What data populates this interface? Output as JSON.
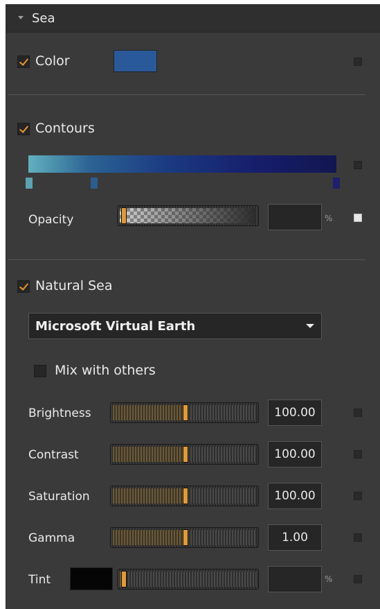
{
  "section": {
    "title": "Sea"
  },
  "color": {
    "label": "Color",
    "checked": true,
    "swatch_color": "#2a5999"
  },
  "contours": {
    "label": "Contours",
    "checked": true,
    "gradient_colors": [
      "#62b0bf",
      "#2b6394",
      "#1b3a82",
      "#161d6a",
      "#121650"
    ],
    "stop_colors": [
      "#5aa3b0",
      "#2a5c90",
      "#1e1f6e"
    ],
    "opacity": {
      "label": "Opacity",
      "value": "",
      "unit": "%"
    }
  },
  "natural_sea": {
    "label": "Natural Sea",
    "checked": true,
    "source": "Microsoft Virtual Earth",
    "mix_label": "Mix with others",
    "mix_checked": false,
    "brightness": {
      "label": "Brightness",
      "value": "100.00",
      "level": 0.5
    },
    "contrast": {
      "label": "Contrast",
      "value": "100.00",
      "level": 0.5
    },
    "saturation": {
      "label": "Saturation",
      "value": "100.00",
      "level": 0.5
    },
    "gamma": {
      "label": "Gamma",
      "value": "1.00",
      "level": 0.5
    },
    "tint": {
      "label": "Tint",
      "value": "",
      "unit": "%",
      "swatch_color": "#050505"
    }
  },
  "icons": {
    "collapse": "triangle-down-icon",
    "dropdown": "chevron-down-icon"
  }
}
